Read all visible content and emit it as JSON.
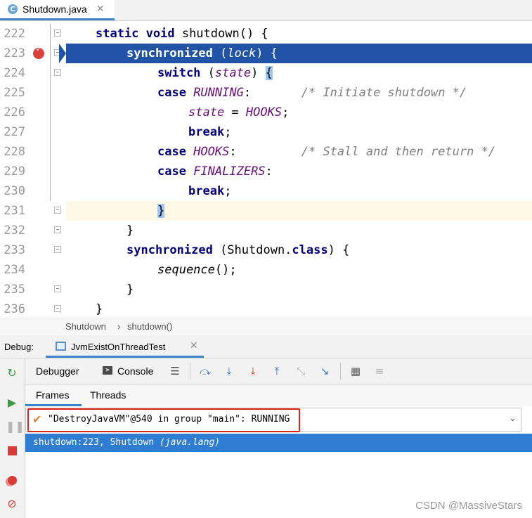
{
  "editor_tab": {
    "icon_letter": "C",
    "file_name": "Shutdown.java",
    "close": "✕"
  },
  "code_lines": [
    {
      "number": "222",
      "indent": 2,
      "tokens": [
        {
          "t": "static void ",
          "c": "k"
        },
        {
          "t": "shutdown() {",
          "c": ""
        }
      ]
    },
    {
      "number": "223",
      "indent": 3,
      "tokens": [
        {
          "t": "synchronized ",
          "c": "k"
        },
        {
          "t": "(",
          "c": ""
        },
        {
          "t": "lock",
          "c": "v"
        },
        {
          "t": ") {",
          "c": ""
        }
      ]
    },
    {
      "number": "224",
      "indent": 4,
      "tokens": [
        {
          "t": "switch ",
          "c": "k"
        },
        {
          "t": "(",
          "c": ""
        },
        {
          "t": "state",
          "c": "v"
        },
        {
          "t": ") ",
          "c": ""
        },
        {
          "t": "{",
          "c": "bh"
        }
      ]
    },
    {
      "number": "225",
      "indent": 4,
      "tokens": [
        {
          "t": "case ",
          "c": "k"
        },
        {
          "t": "RUNNING",
          "c": "v"
        },
        {
          "t": ":       ",
          "c": ""
        },
        {
          "t": "/* Initiate shutdown */",
          "c": "cm"
        }
      ]
    },
    {
      "number": "226",
      "indent": 5,
      "tokens": [
        {
          "t": "state",
          "c": "v"
        },
        {
          "t": " = ",
          "c": ""
        },
        {
          "t": "HOOKS",
          "c": "v"
        },
        {
          "t": ";",
          "c": ""
        }
      ]
    },
    {
      "number": "227",
      "indent": 5,
      "tokens": [
        {
          "t": "break",
          "c": "k"
        },
        {
          "t": ";",
          "c": ""
        }
      ]
    },
    {
      "number": "228",
      "indent": 4,
      "tokens": [
        {
          "t": "case ",
          "c": "k"
        },
        {
          "t": "HOOKS",
          "c": "v"
        },
        {
          "t": ":         ",
          "c": ""
        },
        {
          "t": "/* Stall and then return */",
          "c": "cm"
        }
      ]
    },
    {
      "number": "229",
      "indent": 4,
      "tokens": [
        {
          "t": "case ",
          "c": "k"
        },
        {
          "t": "FINALIZERS",
          "c": "v"
        },
        {
          "t": ":",
          "c": ""
        }
      ]
    },
    {
      "number": "230",
      "indent": 5,
      "tokens": [
        {
          "t": "break",
          "c": "k"
        },
        {
          "t": ";",
          "c": ""
        }
      ]
    },
    {
      "number": "231",
      "indent": 4,
      "tokens": [
        {
          "t": "}",
          "c": "bh"
        }
      ]
    },
    {
      "number": "232",
      "indent": 3,
      "tokens": [
        {
          "t": "}",
          "c": ""
        }
      ]
    },
    {
      "number": "233",
      "indent": 3,
      "tokens": [
        {
          "t": "synchronized ",
          "c": "k"
        },
        {
          "t": "(Shutdown.",
          "c": ""
        },
        {
          "t": "class",
          "c": "k"
        },
        {
          "t": ") {",
          "c": ""
        }
      ]
    },
    {
      "number": "234",
      "indent": 4,
      "tokens": [
        {
          "t": "sequence",
          "c": "i"
        },
        {
          "t": "();",
          "c": ""
        }
      ]
    },
    {
      "number": "235",
      "indent": 3,
      "tokens": [
        {
          "t": "}",
          "c": ""
        }
      ]
    },
    {
      "number": "236",
      "indent": 2,
      "tokens": [
        {
          "t": "}",
          "c": ""
        }
      ]
    }
  ],
  "execution_line": "223",
  "caret_line": "231",
  "fold_lines": [
    "222",
    "223",
    "224",
    "231",
    "232",
    "233",
    "235",
    "236"
  ],
  "breakpoint_line": "223",
  "breadcrumb": {
    "class_name": "Shutdown",
    "separator": "›",
    "method_name": "shutdown()"
  },
  "debug": {
    "label": "Debug:",
    "run_config": "JvmExistOnThreadTest",
    "close": "✕",
    "tabs": {
      "debugger": "Debugger",
      "console": "Console",
      "console_icon": ">"
    },
    "subtabs": {
      "frames": "Frames",
      "threads": "Threads"
    },
    "thread_check": "✔",
    "thread": "\"DestroyJavaVM\"@540 in group \"main\": RUNNING",
    "thread_dropdown": "⌄",
    "frame_main": "shutdown:223, Shutdown ",
    "frame_pkg": "(java.lang)"
  },
  "toolbar_icons": [
    "list-icon",
    "step-over-icon",
    "step-into-icon",
    "force-step-into-icon",
    "step-out-icon",
    "drop-frame-icon",
    "run-to-cursor-icon",
    "evaluate-icon",
    "trace-icon"
  ],
  "colors": {
    "accent": "#2154a6",
    "selection": "#2f7dd3",
    "keyword": "#000080",
    "field": "#660e7a",
    "comment": "#808080",
    "highlight_box": "#e3221a"
  },
  "watermark": "CSDN @MassiveStars"
}
